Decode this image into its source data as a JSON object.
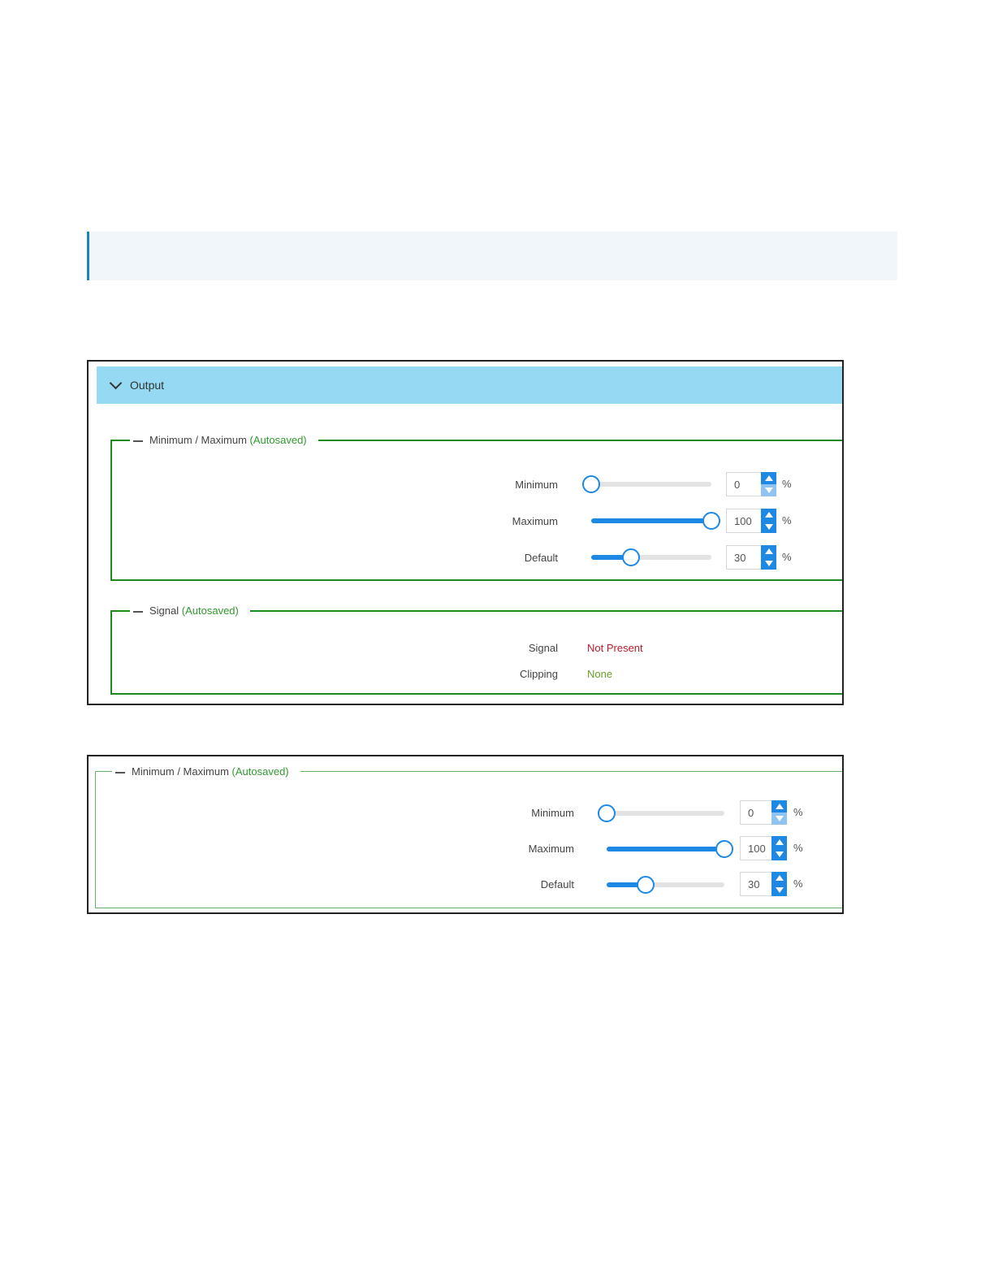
{
  "panel": {
    "title": "Output",
    "minmax_group": {
      "legend_label": "Minimum / Maximum",
      "legend_status": "(Autosaved)",
      "rows": [
        {
          "label": "Minimum",
          "value": "0",
          "percent": 0,
          "unit": "%"
        },
        {
          "label": "Maximum",
          "value": "100",
          "percent": 100,
          "unit": "%"
        },
        {
          "label": "Default",
          "value": "30",
          "percent": 30,
          "unit": "%"
        }
      ]
    },
    "signal_group": {
      "legend_label": "Signal",
      "legend_status": "(Autosaved)",
      "signal_label": "Signal",
      "signal_value": "Not Present",
      "clipping_label": "Clipping",
      "clipping_value": "None"
    }
  },
  "detail": {
    "legend_label": "Minimum / Maximum",
    "legend_status": "(Autosaved)",
    "rows": [
      {
        "label": "Minimum",
        "value": "0",
        "percent": 0,
        "unit": "%"
      },
      {
        "label": "Maximum",
        "value": "100",
        "percent": 100,
        "unit": "%"
      },
      {
        "label": "Default",
        "value": "30",
        "percent": 30,
        "unit": "%"
      }
    ]
  },
  "colors": {
    "header": "#96d9f3",
    "group_border": "#1e8a1e",
    "accent": "#1e88e5",
    "autosaved": "#2f9a2f",
    "not_present": "#b51c2c",
    "none": "#6a9f2a"
  }
}
